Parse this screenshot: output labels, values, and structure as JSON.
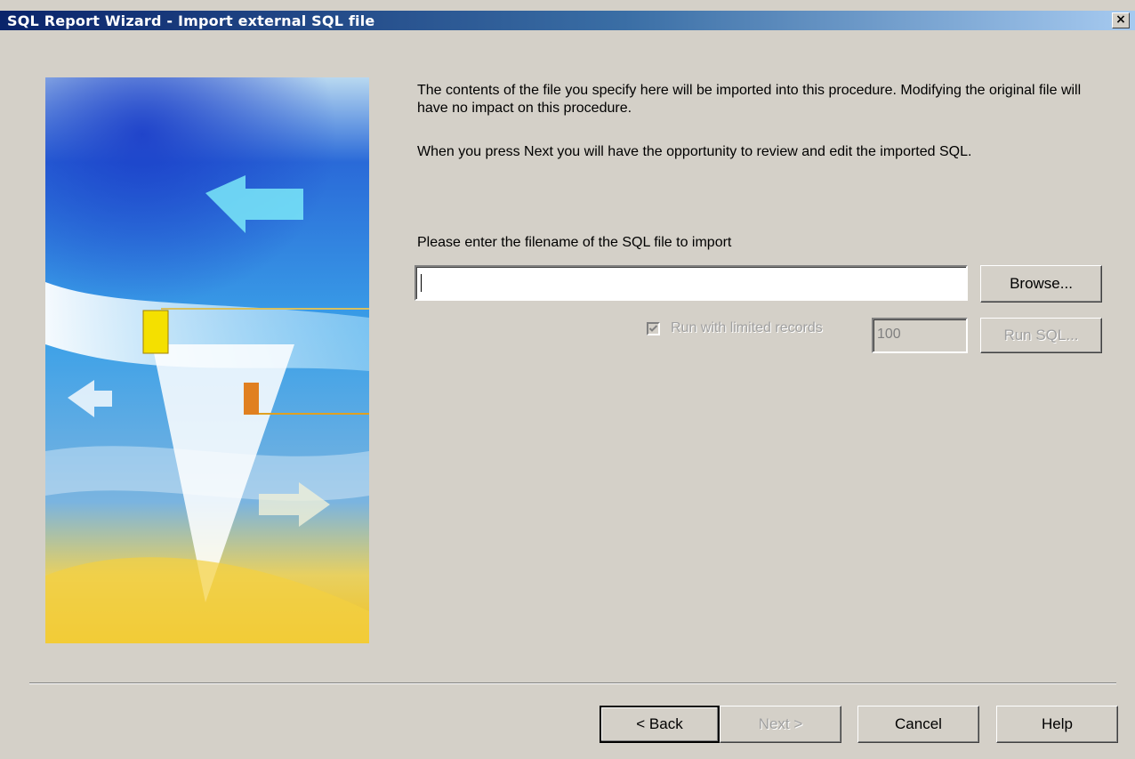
{
  "window": {
    "title": "SQL Report Wizard - Import external SQL file",
    "close_label": "×"
  },
  "intro": {
    "paragraph1": "The contents of the file you specify here will be imported into this procedure.  Modifying the original file will have no impact on this procedure.",
    "paragraph2": "When you press Next you will have the opportunity to review and edit the imported SQL."
  },
  "file": {
    "label": "Please enter the filename of the SQL file to import",
    "value": "",
    "browse_label": "Browse..."
  },
  "limit": {
    "checkbox_label": "Run with limited records",
    "checked": true,
    "value": "100",
    "run_sql_label": "Run SQL..."
  },
  "footer": {
    "back_label": "< Back",
    "next_label": "Next >",
    "cancel_label": "Cancel",
    "help_label": "Help"
  },
  "colors": {
    "dialog_bg": "#d4d0c8",
    "title_start": "#0a246a",
    "title_end": "#a6caf0",
    "disabled_text": "#a0a0a0"
  },
  "icons": {
    "close": "close-icon",
    "checkbox": "checkmark-icon",
    "wizard_art": "wizard-banner-image"
  }
}
